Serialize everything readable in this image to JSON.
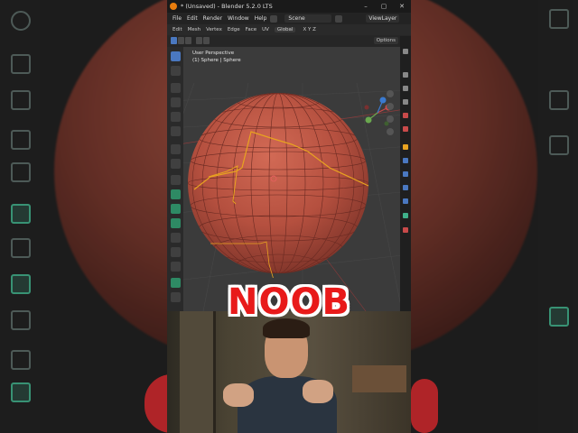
{
  "window": {
    "title": "* (Unsaved) - Blender 5.2.0 LTS",
    "controls": [
      "–",
      "▢",
      "✕"
    ]
  },
  "menubar": {
    "items": [
      "File",
      "Edit",
      "Render",
      "Window",
      "Help"
    ],
    "scene": "Scene",
    "view_layer": "ViewLayer"
  },
  "editor_header": {
    "items": [
      "Edit",
      "Mesh",
      "Vertex",
      "Edge",
      "Face",
      "UV"
    ],
    "orientation": "Global",
    "axes": "X Y Z"
  },
  "viewport": {
    "options_label": "Options",
    "perspective": "User Perspective",
    "object_info": "(1) Sphere | Sphere"
  },
  "caption": {
    "text": "NOOB",
    "color": "#e81a1a"
  },
  "colors": {
    "sphere": "#b5503f",
    "selection_orange": "#e8a320",
    "accent_blue": "#4a78c0"
  }
}
